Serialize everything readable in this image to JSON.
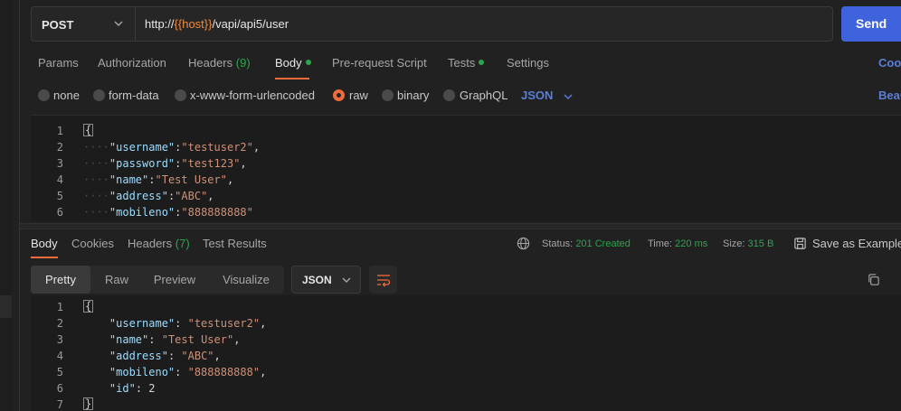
{
  "request": {
    "method": "POST",
    "url_prefix": "http://",
    "url_variable": "{{host}}",
    "url_suffix": "/vapi/api5/user",
    "send_label": "Send"
  },
  "request_tabs": {
    "params": "Params",
    "authorization": "Authorization",
    "headers": "Headers",
    "headers_count": "(9)",
    "body": "Body",
    "prerequest": "Pre-request Script",
    "tests": "Tests",
    "settings": "Settings",
    "cookies_link": "Cook",
    "beautify_link": "Beau"
  },
  "body_types": {
    "none": "none",
    "form_data": "form-data",
    "urlencoded": "x-www-form-urlencoded",
    "raw": "raw",
    "binary": "binary",
    "graphql": "GraphQL",
    "selected": "raw",
    "format": "JSON"
  },
  "request_body": [
    {
      "ln": "1",
      "key": "",
      "val": "",
      "brace": "{"
    },
    {
      "ln": "2",
      "key": "\"username\"",
      "val": "\"testuser2\"",
      "tail": ","
    },
    {
      "ln": "3",
      "key": "\"password\"",
      "val": "\"test123\"",
      "tail": ","
    },
    {
      "ln": "4",
      "key": "\"name\"",
      "val": "\"Test User\"",
      "tail": ","
    },
    {
      "ln": "5",
      "key": "\"address\"",
      "val": "\"ABC\"",
      "tail": ","
    },
    {
      "ln": "6",
      "key": "\"mobileno\"",
      "val": "\"888888888\"",
      "tail": ""
    }
  ],
  "response_tabs": {
    "body": "Body",
    "cookies": "Cookies",
    "headers": "Headers",
    "headers_count": "(7)",
    "test_results": "Test Results"
  },
  "response_status": {
    "status_label": "Status:",
    "status_value": "201 Created",
    "time_label": "Time:",
    "time_value": "220 ms",
    "size_label": "Size:",
    "size_value": "315 B",
    "save_label": "Save as Example"
  },
  "response_view": {
    "pretty": "Pretty",
    "raw": "Raw",
    "preview": "Preview",
    "visualize": "Visualize",
    "format": "JSON"
  },
  "response_body": [
    {
      "ln": "1"
    },
    {
      "ln": "2",
      "key": "\"username\"",
      "val": "\"testuser2\"",
      "tail": ","
    },
    {
      "ln": "3",
      "key": "\"name\"",
      "val": "\"Test User\"",
      "tail": ","
    },
    {
      "ln": "4",
      "key": "\"address\"",
      "val": "\"ABC\"",
      "tail": ","
    },
    {
      "ln": "5",
      "key": "\"mobileno\"",
      "val": "\"888888888\"",
      "tail": ","
    },
    {
      "ln": "6",
      "key": "\"id\"",
      "val": "2",
      "tail": ""
    },
    {
      "ln": "7"
    }
  ],
  "colors": {
    "accent": "#f26b3a",
    "send": "#3e63dd",
    "success": "#2ea44f",
    "variable": "#f28b3b"
  }
}
